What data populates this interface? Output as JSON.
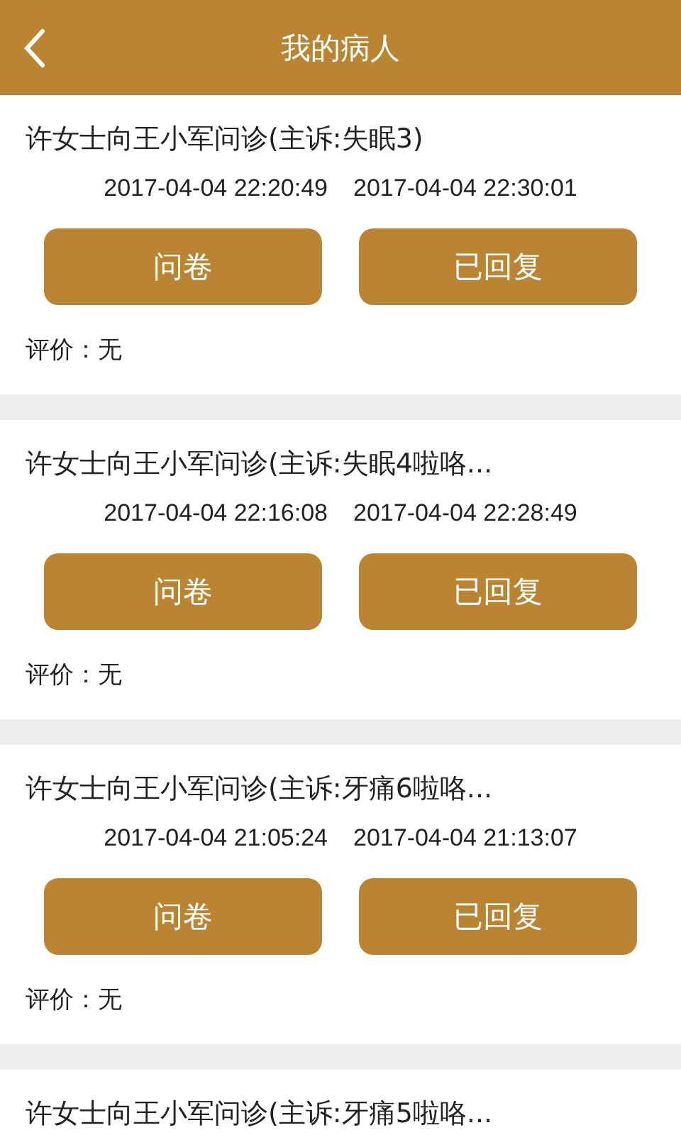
{
  "header": {
    "title": "我的病人"
  },
  "consultations": [
    {
      "title": "许女士向王小军问诊(主诉:失眠3)",
      "start_time": "2017-04-04 22:20:49",
      "end_time": "2017-04-04 22:30:01",
      "buttons": [
        "问卷",
        "已回复"
      ],
      "rating": "评价：无"
    },
    {
      "title": "许女士向王小军问诊(主诉:失眠4啦咯...",
      "start_time": "2017-04-04 22:16:08",
      "end_time": "2017-04-04 22:28:49",
      "buttons": [
        "问卷",
        "已回复"
      ],
      "rating": "评价：无"
    },
    {
      "title": "许女士向王小军问诊(主诉:牙痛6啦咯...",
      "start_time": "2017-04-04 21:05:24",
      "end_time": "2017-04-04 21:13:07",
      "buttons": [
        "问卷",
        "已回复"
      ],
      "rating": "评价：无"
    },
    {
      "title": "许女士向王小军问诊(主诉:牙痛5啦咯..."
    }
  ]
}
